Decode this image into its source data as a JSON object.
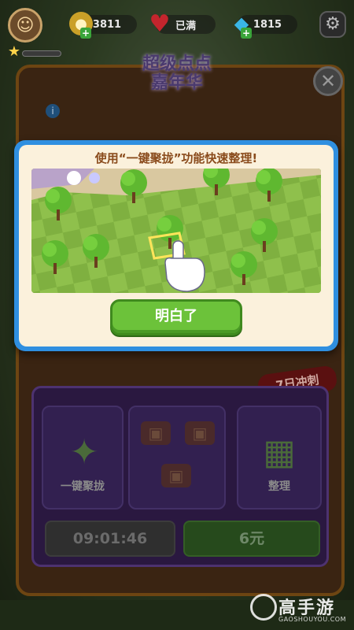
{
  "hud": {
    "coins": "3811",
    "hearts": "已满",
    "gems": "1815"
  },
  "event": {
    "title_line1": "超级点点",
    "title_line2": "嘉年华",
    "sprint_badge": "7日冲刺"
  },
  "offer": {
    "left_label": "一键聚拢",
    "right_label": "整理",
    "timer": "09:01:46",
    "price": "6元"
  },
  "dialog": {
    "heading": "使用“一键聚拢”功能快速整理!",
    "ok_label": "明白了"
  },
  "watermark": {
    "main": "高手游",
    "sub": "GAOSHOUYOU.COM"
  },
  "colors": {
    "dialog_border": "#2f8fe0",
    "dialog_bg": "#fbf1dc",
    "heading": "#8a4b1c",
    "button": "#6cc23a"
  }
}
